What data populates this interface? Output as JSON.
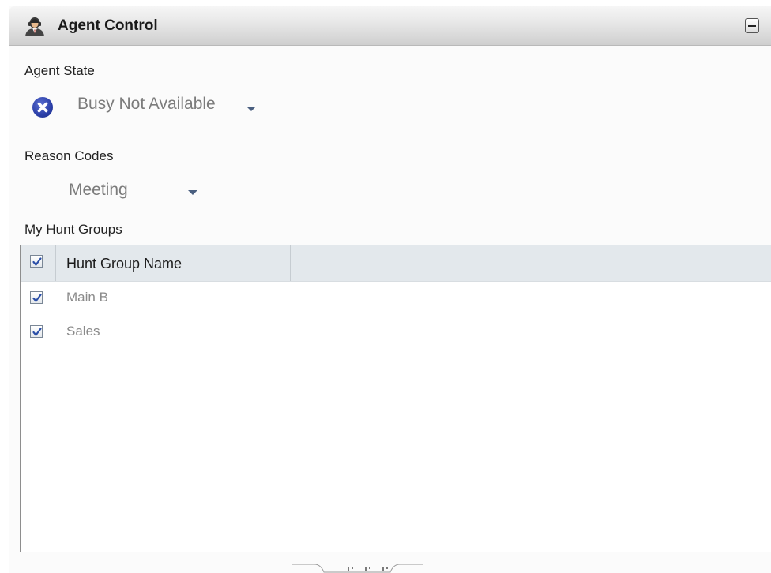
{
  "panel": {
    "title": "Agent Control",
    "title_icon": "agent-person-icon",
    "minimize_icon": "minimize-icon"
  },
  "agent_state": {
    "label": "Agent State",
    "icon": "busy-x-circle-icon",
    "value": "Busy Not Available"
  },
  "reason_codes": {
    "label": "Reason Codes",
    "value": "Meeting"
  },
  "hunt_groups": {
    "label": "My Hunt  Groups",
    "header": {
      "name_column": "Hunt Group Name",
      "select_all_checked": true
    },
    "rows": [
      {
        "name": "Main B",
        "checked": true
      },
      {
        "name": "Sales",
        "checked": true
      }
    ]
  },
  "colors": {
    "state_icon": "#2b3fa8",
    "caret": "#4a5f80",
    "grid_header_bg": "#e3e8ec"
  }
}
